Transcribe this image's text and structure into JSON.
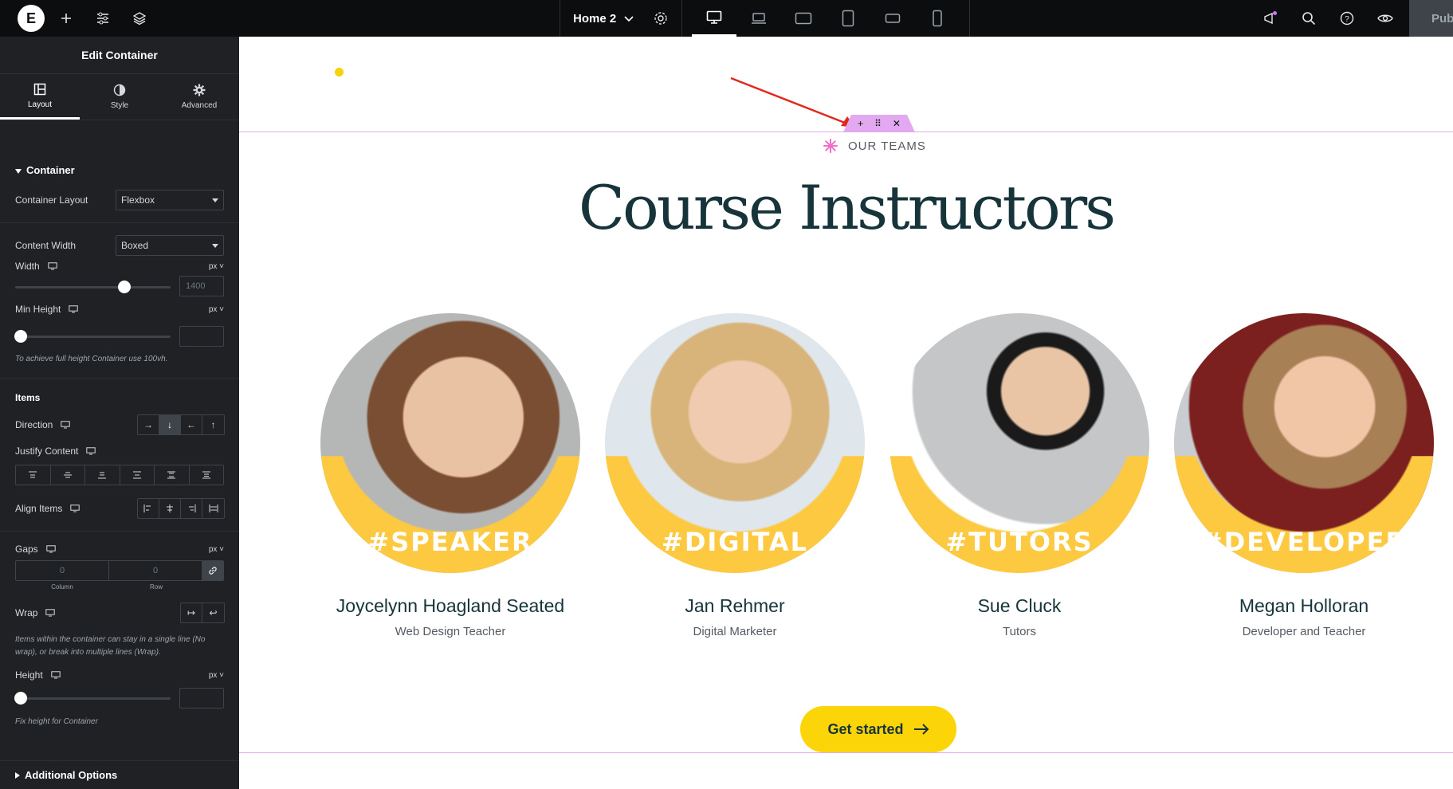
{
  "topbar": {
    "logo_text": "E",
    "page_name": "Home 2",
    "publish_label": "Publish",
    "devices": [
      "desktop",
      "laptop",
      "tablet-landscape",
      "tablet",
      "mobile-landscape",
      "mobile"
    ]
  },
  "panel": {
    "title": "Edit Container",
    "tabs": [
      {
        "label": "Layout",
        "icon": "layout-icon"
      },
      {
        "label": "Style",
        "icon": "half-circle-icon"
      },
      {
        "label": "Advanced",
        "icon": "gear-icon"
      }
    ],
    "container_section": "Container",
    "container_layout_label": "Container Layout",
    "container_layout_value": "Flexbox",
    "content_width_label": "Content Width",
    "content_width_value": "Boxed",
    "width_label": "Width",
    "width_unit": "px",
    "width_value": "1400",
    "width_fraction": 0.7,
    "min_height_label": "Min Height",
    "min_height_unit": "px",
    "min_height_hint": "To achieve full height Container use 100vh.",
    "items_label": "Items",
    "direction_label": "Direction",
    "justify_label": "Justify Content",
    "align_label": "Align Items",
    "gaps_label": "Gaps",
    "gaps_unit": "px",
    "gap_column": "0",
    "gap_row": "0",
    "column_label": "Column",
    "row_label": "Row",
    "wrap_label": "Wrap",
    "wrap_hint": "Items within the container can stay in a single line (No wrap), or break into multiple lines (Wrap).",
    "height_label": "Height",
    "height_unit": "px",
    "height_hint": "Fix height for Container",
    "additional_options": "Additional Options"
  },
  "canvas": {
    "eyebrow": "OUR TEAMS",
    "title": "Course Instructors",
    "cta_label": "Get started",
    "team": [
      {
        "name": "Joycelynn Hoagland Seated",
        "role": "Web Design Teacher",
        "tag": "#SPEAKER"
      },
      {
        "name": "Jan Rehmer",
        "role": "Digital Marketer",
        "tag": "#DIGITAL"
      },
      {
        "name": "Sue Cluck",
        "role": "Tutors",
        "tag": "#TUTORS"
      },
      {
        "name": "Megan Holloran",
        "role": "Developer and Teacher",
        "tag": "#DEVELOPER"
      }
    ]
  },
  "colors": {
    "accent_yellow": "#fcd508",
    "section_outline": "#e2a9f1",
    "heading": "#17343b",
    "arrow": "#e0291d"
  }
}
